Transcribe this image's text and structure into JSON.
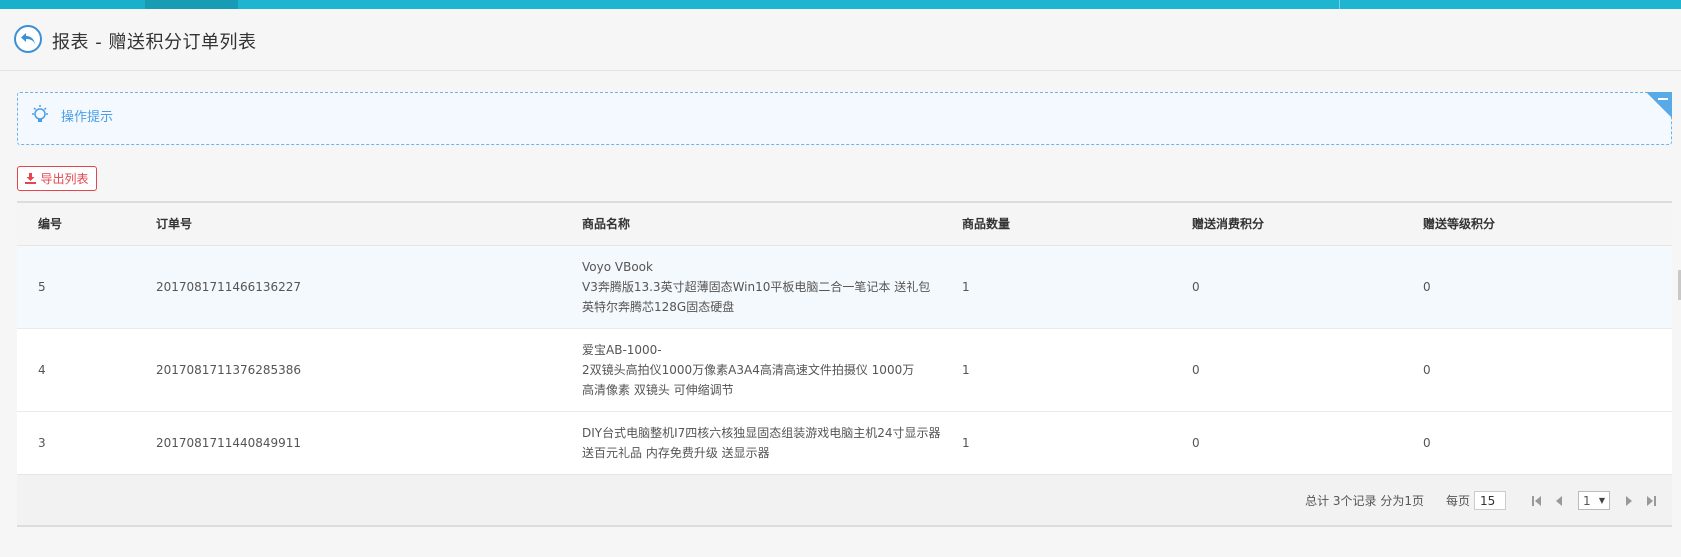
{
  "header": {
    "title": "报表 - 赠送积分订单列表"
  },
  "tips": {
    "label": "操作提示"
  },
  "toolbar": {
    "export_label": "导出列表"
  },
  "table": {
    "columns": [
      "编号",
      "订单号",
      "商品名称",
      "商品数量",
      "赠送消费积分",
      "赠送等级积分"
    ],
    "rows": [
      {
        "id": "5",
        "order_no": "2017081711466136227",
        "product_lines": [
          "Voyo VBook",
          "V3奔腾版13.3英寸超薄固态Win10平板电脑二合一笔记本 送礼包",
          "英特尔奔腾芯128G固态硬盘"
        ],
        "qty": "1",
        "consume_points": "0",
        "level_points": "0"
      },
      {
        "id": "4",
        "order_no": "2017081711376285386",
        "product_lines": [
          "爱宝AB-1000-",
          "2双镜头高拍仪1000万像素A3A4高清高速文件拍摄仪 1000万",
          "高清像素 双镜头 可伸缩调节"
        ],
        "qty": "1",
        "consume_points": "0",
        "level_points": "0"
      },
      {
        "id": "3",
        "order_no": "2017081711440849911",
        "product_lines": [
          "DIY台式电脑整机I7四核六核独显固态组装游戏电脑主机24寸显示器",
          "送百元礼品 内存免费升级 送显示器"
        ],
        "qty": "1",
        "consume_points": "0",
        "level_points": "0"
      }
    ]
  },
  "pagination": {
    "summary": "总计 3个记录 分为1页",
    "per_page_label": "每页",
    "per_page_value": "15",
    "current_page": "1"
  },
  "colors": {
    "topbar": "#1fb5d1",
    "accent_blue": "#4a9ee6",
    "export_red": "#e3464c"
  },
  "icons": {
    "back": "back-arrow-icon",
    "tips": "lightbulb-icon",
    "export": "download-icon",
    "first": "first-page-icon",
    "prev": "prev-page-icon",
    "next": "next-page-icon",
    "last": "last-page-icon"
  }
}
